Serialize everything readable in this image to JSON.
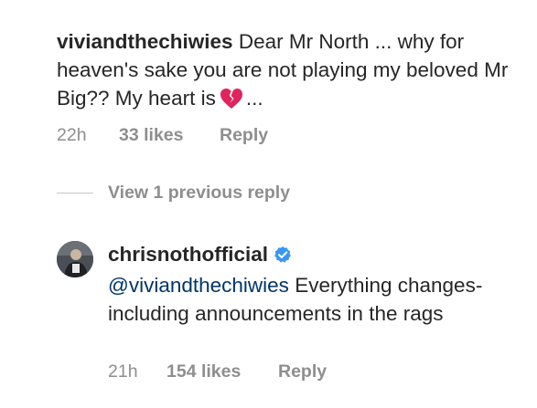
{
  "comments": [
    {
      "username": "viviandthechiwies",
      "text_before_emoji": "Dear Mr North ... why for heaven's sake you are not playing my beloved Mr Big?? My heart is",
      "emoji": "broken-heart-icon",
      "text_after_emoji": "...",
      "time": "22h",
      "likes": "33 likes",
      "reply_label": "Reply"
    }
  ],
  "replies_toggle": {
    "label": "View 1 previous reply"
  },
  "reply": {
    "username": "chrisnothofficial",
    "verified": true,
    "mention": "@viviandthechiwies",
    "text": "Everything changes- including announcements in the rags",
    "time": "21h",
    "likes": "154 likes",
    "reply_label": "Reply",
    "avatar": "profile-photo"
  },
  "colors": {
    "text": "#262626",
    "meta": "#8e8e8e",
    "mention": "#003569",
    "verified": "#3897f0",
    "broken_heart": "#e0245e"
  }
}
